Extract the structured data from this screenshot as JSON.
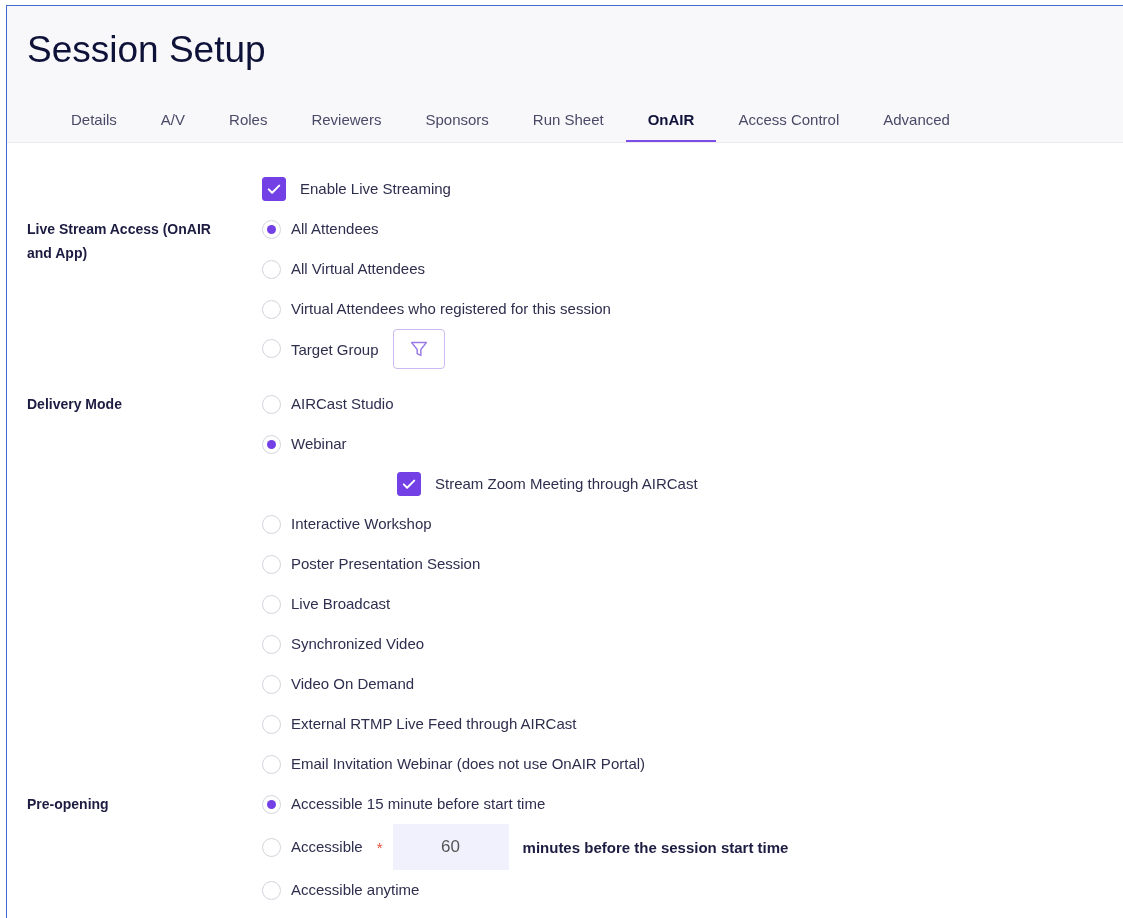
{
  "title": "Session Setup",
  "tabs": [
    {
      "label": "Details",
      "selected": false
    },
    {
      "label": "A/V",
      "selected": false
    },
    {
      "label": "Roles",
      "selected": false
    },
    {
      "label": "Reviewers",
      "selected": false
    },
    {
      "label": "Sponsors",
      "selected": false
    },
    {
      "label": "Run Sheet",
      "selected": false
    },
    {
      "label": "OnAIR",
      "selected": true
    },
    {
      "label": "Access Control",
      "selected": false
    },
    {
      "label": "Advanced",
      "selected": false
    }
  ],
  "enable_live_streaming": {
    "label": "Enable Live Streaming",
    "checked": true
  },
  "sections": [
    {
      "label": "Live Stream Access (OnAIR and App)",
      "options": [
        {
          "kind": "radio",
          "label": "All Attendees",
          "selected": true
        },
        {
          "kind": "radio",
          "label": "All Virtual Attendees",
          "selected": false
        },
        {
          "kind": "radio",
          "label": "Virtual Attendees who registered for this session",
          "selected": false
        },
        {
          "kind": "filter",
          "label": "Target Group",
          "selected": false
        }
      ]
    },
    {
      "label": "Delivery Mode",
      "options": [
        {
          "kind": "radio",
          "label": "AIRCast Studio",
          "selected": false
        },
        {
          "kind": "radio",
          "label": "Webinar",
          "selected": true,
          "sub_option": {
            "label": "Stream Zoom Meeting through AIRCast",
            "checked": true
          }
        },
        {
          "kind": "radio",
          "label": "Interactive Workshop",
          "selected": false
        },
        {
          "kind": "radio",
          "label": "Poster Presentation Session",
          "selected": false
        },
        {
          "kind": "radio",
          "label": "Live Broadcast",
          "selected": false
        },
        {
          "kind": "radio",
          "label": "Synchronized Video",
          "selected": false
        },
        {
          "kind": "radio",
          "label": "Video On Demand",
          "selected": false
        },
        {
          "kind": "radio",
          "label": "External RTMP Live Feed through AIRCast",
          "selected": false
        },
        {
          "kind": "radio",
          "label": "Email Invitation Webinar (does not use OnAIR Portal)",
          "selected": false
        }
      ]
    },
    {
      "label": "Pre-opening",
      "options": [
        {
          "kind": "radio",
          "label": "Accessible 15 minute before start time",
          "selected": true
        },
        {
          "kind": "minutes",
          "label": "Accessible",
          "selected": false,
          "required_mark": "*",
          "value": "60",
          "suffix": "minutes before the session start time"
        },
        {
          "kind": "radio",
          "label": "Accessible anytime",
          "selected": false
        }
      ]
    }
  ]
}
